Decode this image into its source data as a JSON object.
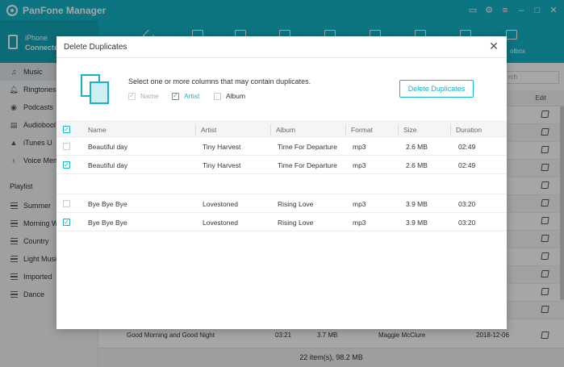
{
  "app": {
    "title": "PanFone Manager",
    "accent_color": "#14b3c6"
  },
  "window_controls": [
    "feedback-icon",
    "settings-icon",
    "menu-icon",
    "minimize-icon",
    "maximize-icon",
    "close-icon"
  ],
  "device": {
    "name": "iPhone",
    "status": "Connecte"
  },
  "toolbar": {
    "toolbox_label": "olbox"
  },
  "sidebar": {
    "items": [
      {
        "label": "Music",
        "icon": "music-note-icon",
        "active": true
      },
      {
        "label": "Ringtones",
        "icon": "bell-icon"
      },
      {
        "label": "Podcasts",
        "icon": "podcast-icon"
      },
      {
        "label": "Audiobool",
        "icon": "book-icon"
      },
      {
        "label": "iTunes U",
        "icon": "graduation-cap-icon"
      },
      {
        "label": "Voice Men",
        "icon": "microphone-icon"
      }
    ],
    "playlist_heading": "Playlist",
    "playlists": [
      "Summer",
      "Morning W",
      "Country",
      "Light Musi",
      "Imported",
      "Dance"
    ]
  },
  "main": {
    "search_placeholder": "rch",
    "edit_header": "Edit",
    "visible_row": {
      "name": "Good Morning and Good Night",
      "duration": "03:21",
      "size": "3.7 MB",
      "artist": "Maggie McClure",
      "date": "2018-12-06"
    },
    "status": "22 item(s), 98.2 MB"
  },
  "dialog": {
    "title": "Delete Duplicates",
    "instruction": "Select one or more columns that may contain duplicates.",
    "options": [
      {
        "label": "Name",
        "checked": true,
        "disabled": true
      },
      {
        "label": "Artist",
        "checked": true,
        "disabled": false
      },
      {
        "label": "Album",
        "checked": false,
        "disabled": false
      }
    ],
    "button_label": "Delete Duplicates",
    "columns": [
      "Name",
      "Artist",
      "Album",
      "Format",
      "Size",
      "Duration"
    ],
    "groups": [
      [
        {
          "checked": false,
          "name": "Beautiful day",
          "artist": "Tiny Harvest",
          "album": "Time For Departure",
          "format": "mp3",
          "size": "2.6 MB",
          "duration": "02:49"
        },
        {
          "checked": true,
          "name": "Beautiful day",
          "artist": "Tiny Harvest",
          "album": "Time For Departure",
          "format": "mp3",
          "size": "2.6 MB",
          "duration": "02:49"
        }
      ],
      [
        {
          "checked": false,
          "name": "Bye Bye Bye",
          "artist": "Lovestoned",
          "album": "Rising Love",
          "format": "mp3",
          "size": "3.9 MB",
          "duration": "03:20"
        },
        {
          "checked": true,
          "name": "Bye Bye Bye",
          "artist": "Lovestoned",
          "album": "Rising Love",
          "format": "mp3",
          "size": "3.9 MB",
          "duration": "03:20"
        }
      ]
    ]
  }
}
